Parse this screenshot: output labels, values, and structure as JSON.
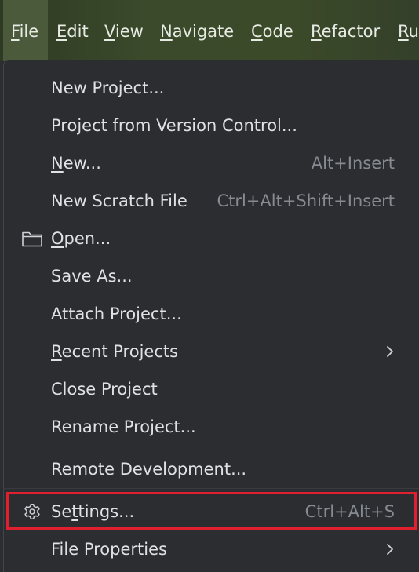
{
  "menubar": {
    "items": [
      {
        "mnemonic": "F",
        "rest": "ile"
      },
      {
        "mnemonic": "E",
        "rest": "dit"
      },
      {
        "mnemonic": "V",
        "rest": "iew"
      },
      {
        "mnemonic": "N",
        "rest": "avigate"
      },
      {
        "mnemonic": "C",
        "rest": "ode"
      },
      {
        "mnemonic": "R",
        "rest": "efactor"
      },
      {
        "mnemonic": "R",
        "rest": "u"
      }
    ]
  },
  "file_menu": {
    "new_project": "New Project...",
    "project_from_vcs": "Project from Version Control...",
    "new": {
      "mnemonic": "N",
      "rest": "ew...",
      "shortcut": "Alt+Insert"
    },
    "new_scratch": {
      "label": "New Scratch File",
      "shortcut": "Ctrl+Alt+Shift+Insert"
    },
    "open": {
      "mnemonic": "O",
      "rest": "pen...",
      "icon": "folder-icon"
    },
    "save_as": "Save As...",
    "attach_project": "Attach Project...",
    "recent_projects": {
      "mnemonic": "R",
      "rest": "ecent Projects"
    },
    "close_project": "Close Project",
    "rename_project": "Rename Project...",
    "remote_development": "Remote Development...",
    "settings": {
      "pre": "Se",
      "mnemonic": "t",
      "rest": "tings...",
      "shortcut": "Ctrl+Alt+S",
      "icon": "gear-icon"
    },
    "file_properties": "File Properties"
  },
  "colors": {
    "menu_background": "#2b2d30",
    "text": "#dfe1e5",
    "shortcut_text": "#868a91",
    "highlight_border": "#e0202f"
  }
}
